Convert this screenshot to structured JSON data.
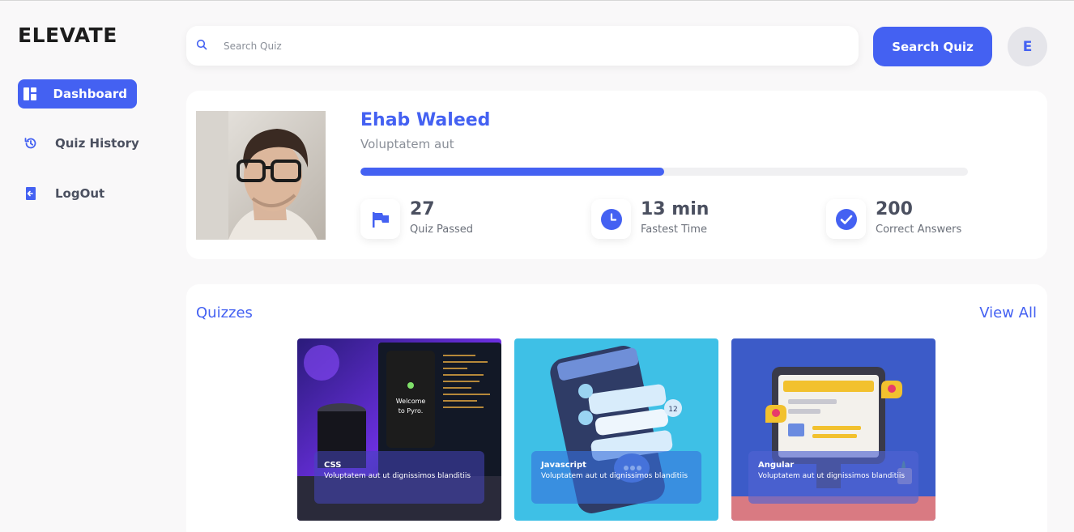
{
  "brand": {
    "logo_text": "ELEVATE"
  },
  "sidebar": {
    "items": [
      {
        "label": "Dashboard",
        "icon": "dashboard-icon",
        "active": true
      },
      {
        "label": "Quiz History",
        "icon": "history-icon",
        "active": false
      },
      {
        "label": "LogOut",
        "icon": "logout-icon",
        "active": false
      }
    ]
  },
  "header": {
    "search_placeholder": "Search Quiz",
    "search_button": "Search Quiz",
    "avatar_initial": "E"
  },
  "profile": {
    "name": "Ehab Waleed",
    "subtitle": "Voluptatem aut",
    "progress_fraction": 0.5,
    "stats": [
      {
        "value": "27",
        "label": "Quiz Passed",
        "icon": "flag-icon"
      },
      {
        "value": "13 min",
        "label": "Fastest Time",
        "icon": "clock-icon"
      },
      {
        "value": "200",
        "label": "Correct Answers",
        "icon": "check-icon"
      }
    ]
  },
  "quizzes": {
    "title": "Quizzes",
    "view_all": "View All",
    "items": [
      {
        "title": "CSS",
        "description": "Voluptatem aut ut dignissimos blanditiis"
      },
      {
        "title": "Javascript",
        "description": "Voluptatem aut ut dignissimos blanditiis"
      },
      {
        "title": "Angular",
        "description": "Voluptatem aut ut dignissimos blanditiis"
      }
    ]
  },
  "colors": {
    "accent": "#4461f2",
    "background": "#f9f8f9"
  }
}
